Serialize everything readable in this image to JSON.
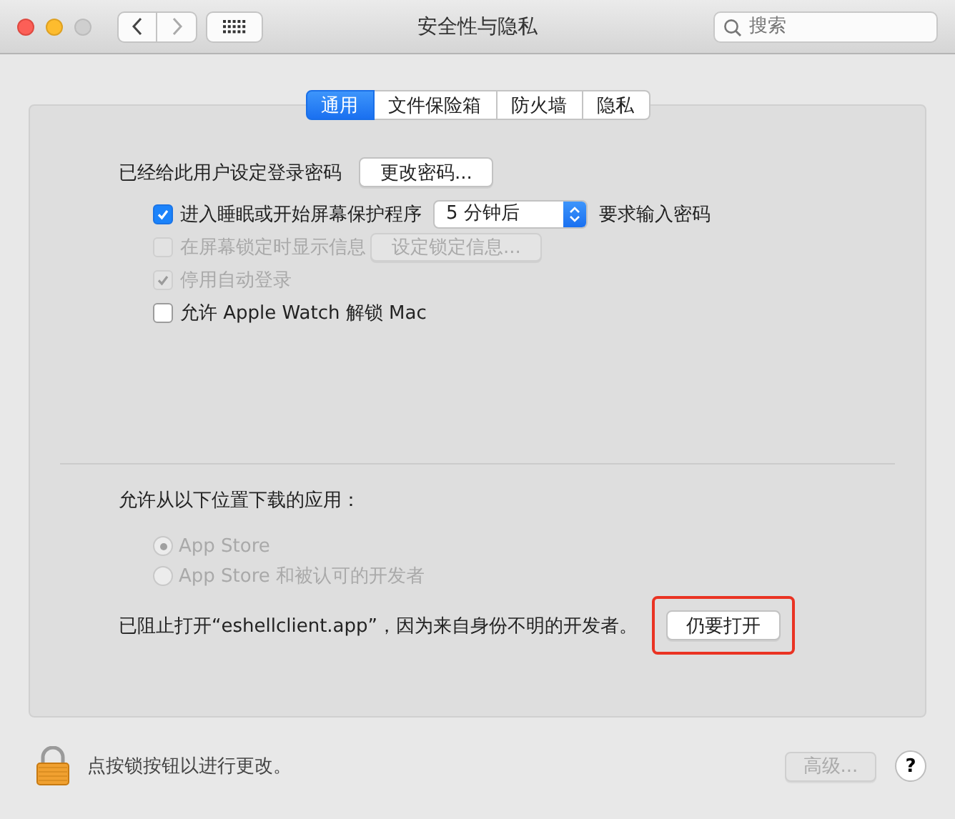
{
  "window": {
    "title": "安全性与隐私"
  },
  "toolbar": {
    "search": {
      "placeholder": "搜索"
    }
  },
  "tabs": [
    {
      "label": "通用",
      "selected": true
    },
    {
      "label": "文件保险箱",
      "selected": false
    },
    {
      "label": "防火墙",
      "selected": false
    },
    {
      "label": "隐私",
      "selected": false
    }
  ],
  "password": {
    "label": "已经给此用户设定登录密码",
    "button": "更改密码..."
  },
  "options": [
    {
      "kind": "delay",
      "checked": true,
      "disabled": false,
      "label": "进入睡眠或开始屏幕保护程序",
      "select": "5 分钟后",
      "suffix": "要求输入密码"
    },
    {
      "kind": "button",
      "checked": false,
      "disabled": true,
      "label": "在屏幕锁定时显示信息",
      "button": "设定锁定信息..."
    },
    {
      "kind": "plain",
      "checked": true,
      "disabled": true,
      "label": "停用自动登录"
    },
    {
      "kind": "plain",
      "checked": false,
      "disabled": false,
      "label": "允许 Apple Watch 解锁 Mac"
    }
  ],
  "downloads": {
    "label": "允许从以下位置下载的应用：",
    "sources": [
      {
        "label": "App Store",
        "selected": true,
        "disabled": true
      },
      {
        "label": "App Store 和被认可的开发者",
        "selected": false,
        "disabled": true
      }
    ],
    "blocked": {
      "message": "已阻止打开“eshellclient.app”，因为来自身份不明的开发者。",
      "button": "仍要打开",
      "highlighted": true
    }
  },
  "footer": {
    "lock_message": "点按锁按钮以进行更改。",
    "advanced": {
      "label": "高级...",
      "disabled": true
    },
    "help": "?"
  }
}
